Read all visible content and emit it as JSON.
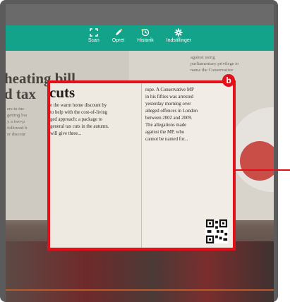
{
  "toolbar": {
    "items": [
      {
        "label": "Scan",
        "icon": "scan-icon",
        "active": true
      },
      {
        "label": "Opret",
        "icon": "pen-icon"
      },
      {
        "label": "Historik",
        "icon": "history-icon"
      },
      {
        "label": "Indstillinger",
        "icon": "settings-gear-icon"
      }
    ]
  },
  "background_article": {
    "headline_line1": "heating bill",
    "headline_line2": "d tax",
    "left_text": [
      "ers to inc",
      "getting loa",
      "y a two-p",
      "followed b",
      "er discour"
    ],
    "right_top_text": [
      "against using",
      "parliamentary privilege to",
      "name the Conservative"
    ]
  },
  "scanned_document": {
    "title": "cuts",
    "left_column": [
      "e the warm home discount by",
      "to help with the cost-of-living",
      "ged approach: a package to",
      "general tax cuts in the autumn.",
      "will give three..."
    ],
    "right_column": [
      "rupe. A Conservative MP",
      "in his fifties was arrested",
      "yesterday morning over",
      "alleged offences in London",
      "between 2002 and 2009.",
      "The allegations made",
      "against the MP, who",
      "cannot be named for..."
    ]
  },
  "annotation": {
    "badge": "b"
  },
  "colors": {
    "toolbar": "#13a38a",
    "highlight": "#e3101a"
  }
}
